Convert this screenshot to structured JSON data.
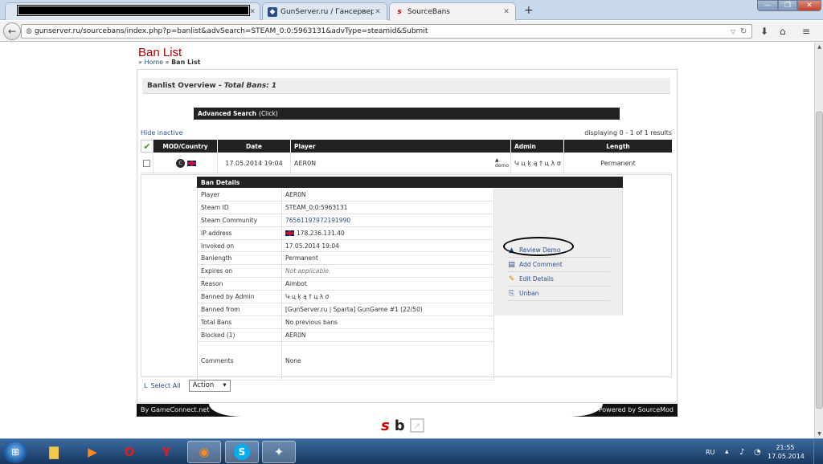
{
  "browser": {
    "tabs": [
      {
        "label": "",
        "icon": "redacted-tab-icon"
      },
      {
        "label": "GunServer.ru / Гансервер ...",
        "icon": "gunserver-favicon"
      },
      {
        "label": "SourceBans",
        "icon": "sourcebans-favicon",
        "active": true
      }
    ],
    "new_tab": "+",
    "url": "gunserver.ru/sourcebans/index.php?p=banlist&advSearch=STEAM_0:0:5963131&advType=steamid&Submit",
    "window_controls": {
      "minimize": "—",
      "maximize": "❐",
      "close": "✕"
    }
  },
  "page": {
    "title": "Ban List",
    "breadcrumb": {
      "sep": "»",
      "home": "Home",
      "current": "Ban List"
    },
    "overview": {
      "label": "Banlist Overview -",
      "total": "Total Bans: 1"
    },
    "advanced_search": {
      "label": "Advanced Search",
      "hint": "(Click)"
    },
    "hide_inactive": "Hide inactive",
    "displaying": "displaying 0 - 1 of 1 results",
    "columns": {
      "mod_country": "MOD/Country",
      "date": "Date",
      "player": "Player",
      "admin": "Admin",
      "length": "Length"
    },
    "ban": {
      "date": "17.05.2014 19:04",
      "player": "AER0N",
      "admin": "Կ ц ķ ą † ц λ σ",
      "length": "Permanent",
      "demo_icon_label": "demo"
    },
    "details": {
      "header": "Ban Details",
      "rows": [
        {
          "k": "Player",
          "v": "AER0N"
        },
        {
          "k": "Steam ID",
          "v": "STEAM_0:0:5963131"
        },
        {
          "k": "Steam Community",
          "v": "76561197972191990"
        },
        {
          "k": "IP address",
          "v": "178.236.131.40"
        },
        {
          "k": "Invoked on",
          "v": "17.05.2014 19:04"
        },
        {
          "k": "Banlength",
          "v": "Permanent"
        },
        {
          "k": "Expires on",
          "v": "Not applicable."
        },
        {
          "k": "Reason",
          "v": "Aimbot"
        },
        {
          "k": "Banned by Admin",
          "v": "Կ ц ķ ą † ц λ σ"
        },
        {
          "k": "Banned from",
          "v": "[GunServer.ru | Sparta] GunGame #1 (22/50)"
        },
        {
          "k": "Total Bans",
          "v": "No previous bans"
        },
        {
          "k": "Blocked (1)",
          "v": "AER0N"
        },
        {
          "k": "Comments",
          "v": "None"
        }
      ],
      "actions": [
        {
          "label": "Review Demo",
          "icon": "demo-icon"
        },
        {
          "label": "Add Comment",
          "icon": "comment-icon"
        },
        {
          "label": "Edit Details",
          "icon": "pencil-icon"
        },
        {
          "label": "Unban",
          "icon": "unban-icon"
        }
      ]
    },
    "select_all": "Select All",
    "select_corner": "L",
    "action_select": "Action",
    "footer_left": "By GameConnect.net",
    "footer_right": "Powered by SourceMod"
  },
  "taskbar": {
    "language": "RU",
    "time": "21:55",
    "date": "17.05.2014"
  },
  "colors": {
    "title_red": "#b30000",
    "link_blue": "#2a4e8b",
    "header_dark": "#222222"
  }
}
